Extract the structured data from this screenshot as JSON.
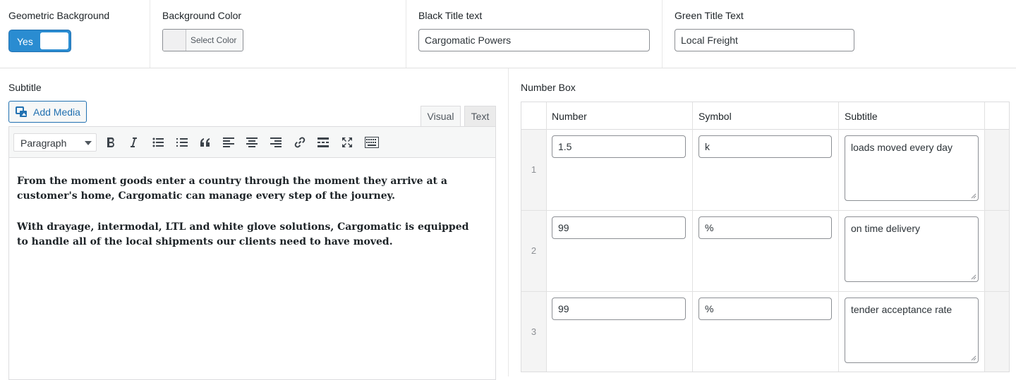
{
  "top": {
    "geometric_background": {
      "label": "Geometric Background",
      "toggle_text": "Yes"
    },
    "background_color": {
      "label": "Background Color",
      "button_label": "Select Color"
    },
    "black_title": {
      "label": "Black Title text",
      "value": "Cargomatic Powers"
    },
    "green_title": {
      "label": "Green Title Text",
      "value": "Local Freight"
    }
  },
  "subtitle": {
    "label": "Subtitle",
    "add_media_label": "Add Media",
    "tabs": {
      "visual": "Visual",
      "text": "Text"
    },
    "format_select": "Paragraph",
    "toolbar_icons": [
      "bold-icon",
      "italic-icon",
      "bullet-list-icon",
      "numbered-list-icon",
      "blockquote-icon",
      "align-left-icon",
      "align-center-icon",
      "align-right-icon",
      "link-icon",
      "read-more-icon",
      "fullscreen-icon",
      "toolbar-toggle-icon"
    ],
    "paragraphs": [
      "From the moment goods enter a country through the moment they arrive at a customer's home, Cargomatic can manage every step of the journey.",
      "With drayage, intermodal, LTL and white glove solutions, Cargomatic is equipped to handle all of the local shipments our clients need to have moved."
    ]
  },
  "number_box": {
    "label": "Number Box",
    "columns": [
      "Number",
      "Symbol",
      "Subtitle"
    ],
    "rows": [
      {
        "index": "1",
        "number": "1.5",
        "symbol": "k",
        "subtitle": "loads moved every day"
      },
      {
        "index": "2",
        "number": "99",
        "symbol": "%",
        "subtitle": "on time delivery"
      },
      {
        "index": "3",
        "number": "99",
        "symbol": "%",
        "subtitle": "tender acceptance rate"
      }
    ]
  },
  "colors": {
    "accent": "#2271b1",
    "toggle_bg": "#2a8cd1",
    "border": "#dcdcde"
  }
}
